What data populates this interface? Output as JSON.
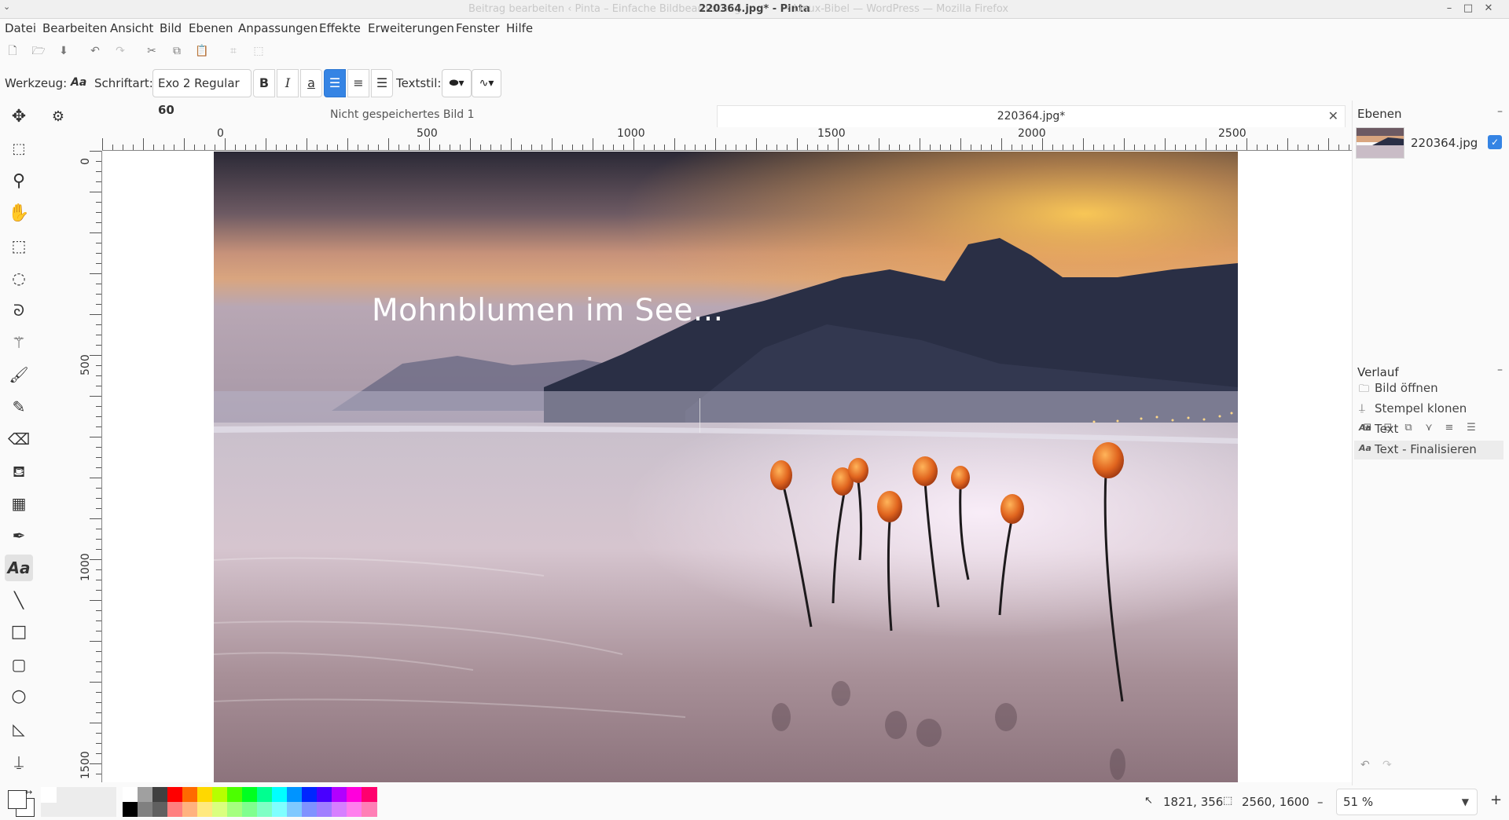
{
  "window": {
    "title": "220364.jpg* - Pinta",
    "background_title_left": "Beitrag bearbeiten ‹ Pinta – Einfache Bildbearbeitung",
    "background_title_right": "‹ Linux-Bibel — WordPress — Mozilla Firefox",
    "minimize": "–",
    "maximize": "□",
    "close": "✕"
  },
  "menu": [
    "Datei",
    "Bearbeiten",
    "Ansicht",
    "Bild",
    "Ebenen",
    "Anpassungen",
    "Effekte",
    "Erweiterungen",
    "Fenster",
    "Hilfe"
  ],
  "quickbar_icons": [
    "new-icon",
    "open-icon",
    "save-icon",
    "undo-icon",
    "redo-icon",
    "cut-icon",
    "copy-icon",
    "paste-icon",
    "crop-icon",
    "deselect-icon"
  ],
  "toolbar": {
    "tool_label": "Werkzeug:",
    "tool_icon_text": "Aa",
    "font_label": "Schriftart:",
    "font_name": "Exo 2 Regular",
    "font_size": "60",
    "bold": "B",
    "italic": "I",
    "underline": "a",
    "text_style_label": "Textstil:"
  },
  "tools": [
    "move-selected-icon",
    "move-selection-icon",
    "zoom-icon",
    "pan-icon",
    "rectangle-select-icon",
    "ellipse-select-icon",
    "lasso-select-icon",
    "magic-wand-icon",
    "paintbrush-icon",
    "pencil-icon",
    "eraser-icon",
    "paint-bucket-icon",
    "gradient-icon",
    "color-picker-icon",
    "text-icon",
    "line-icon",
    "rectangle-icon",
    "rounded-rectangle-icon",
    "ellipse-icon",
    "freeform-icon",
    "clone-stamp-icon"
  ],
  "documents": {
    "inactive_tab": "Nicht gespeichertes Bild 1",
    "active_tab": "220364.jpg*"
  },
  "rulers": {
    "horizontal": [
      "0",
      "500",
      "1000",
      "1500",
      "2000",
      "2500"
    ],
    "vertical": [
      "0",
      "500",
      "1000",
      "1500"
    ]
  },
  "canvas": {
    "overlay_text": "Mohnblumen im See..."
  },
  "layers": {
    "title": "Ebenen",
    "items": [
      {
        "name": "220364.jpg",
        "visible": true
      }
    ]
  },
  "history": {
    "title": "Verlauf",
    "items": [
      {
        "label": "Bild öffnen",
        "icon": "folder-icon"
      },
      {
        "label": "Stempel klonen",
        "icon": "clone-stamp-icon"
      },
      {
        "label": "Text",
        "icon": "text-icon"
      },
      {
        "label": "Text - Finalisieren",
        "icon": "text-icon",
        "selected": true
      }
    ]
  },
  "status": {
    "cursor_position": "1821, 356",
    "image_size": "2560, 1600",
    "zoom": "51 %",
    "zoom_out": "–",
    "zoom_in": "+"
  },
  "palette": {
    "primary": "#ffffff",
    "secondary": "#ffffff",
    "top_row": [
      "#ffffff",
      "#a0a0a0",
      "#404040",
      "#ff0000",
      "#ff6a00",
      "#ffd800",
      "#b6ff00",
      "#4cff00",
      "#00ff21",
      "#00ff90",
      "#00ffff",
      "#0094ff",
      "#0026ff",
      "#4800ff",
      "#b200ff",
      "#ff00dc",
      "#ff006e"
    ],
    "bottom_row": [
      "#000000",
      "#808080",
      "#606060",
      "#ff7f7f",
      "#ffb27f",
      "#ffe97f",
      "#daff7f",
      "#a5ff7f",
      "#7fff8e",
      "#7fffc5",
      "#7fffff",
      "#7fc9ff",
      "#7f92ff",
      "#a17fff",
      "#d67fff",
      "#ff7fed",
      "#ff7fb6"
    ]
  },
  "accent": "#3584e4"
}
